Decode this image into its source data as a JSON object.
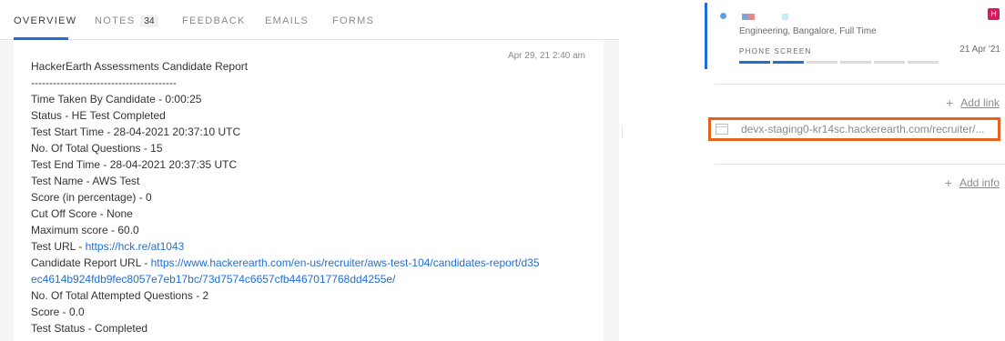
{
  "tabs": [
    {
      "label": "OVERVIEW",
      "active": true
    },
    {
      "label": "NOTES",
      "active": false,
      "count": "34"
    },
    {
      "label": "FEEDBACK",
      "active": false
    },
    {
      "label": "EMAILS",
      "active": false
    },
    {
      "label": "FORMS",
      "active": false
    }
  ],
  "note": {
    "timestamp": "Apr 29, 21 2:40 am",
    "title": "HackerEarth Assessments Candidate Report",
    "separator": "----------------------------------------",
    "lines": [
      "Time Taken By Candidate - 0:00:25",
      "Status - HE Test Completed",
      "Test Start Time - 28-04-2021 20:37:10 UTC",
      "No. Of Total Questions - 15",
      "Test End Time - 28-04-2021 20:37:35 UTC",
      "Test Name - AWS Test",
      "Score (in percentage) - 0",
      "Cut Off Score - None",
      "Maximum score - 60.0"
    ],
    "test_url_label": "Test URL - ",
    "test_url": "https://hck.re/at1043",
    "report_url_label": "Candidate Report URL - ",
    "report_url": "https://www.hackerearth.com/en-us/recruiter/aws-test-104/candidates-report/d35ec4614b924fdb9fec8057e7eb17bc/73d7574c6657cfb4467017768dd4255e/",
    "lines_after": [
      "No. Of Total Attempted Questions - 2",
      "Score - 0.0",
      "Test Status - Completed"
    ]
  },
  "application": {
    "subtitle": "Engineering, Bangalore, Full Time",
    "stage": "PHONE SCREEN",
    "date": "21 Apr '21",
    "avatar_letter": "H",
    "progress_total": 6,
    "progress_done": 2,
    "colors": {
      "accent": "#1f6ed4",
      "avatar": "#d81b60"
    }
  },
  "links": {
    "add_link_label": "Add link",
    "url": "devx-staging0-kr14sc.hackerearth.com/recruiter/...",
    "add_info_label": "Add info",
    "highlight_color": "#e8621f"
  }
}
